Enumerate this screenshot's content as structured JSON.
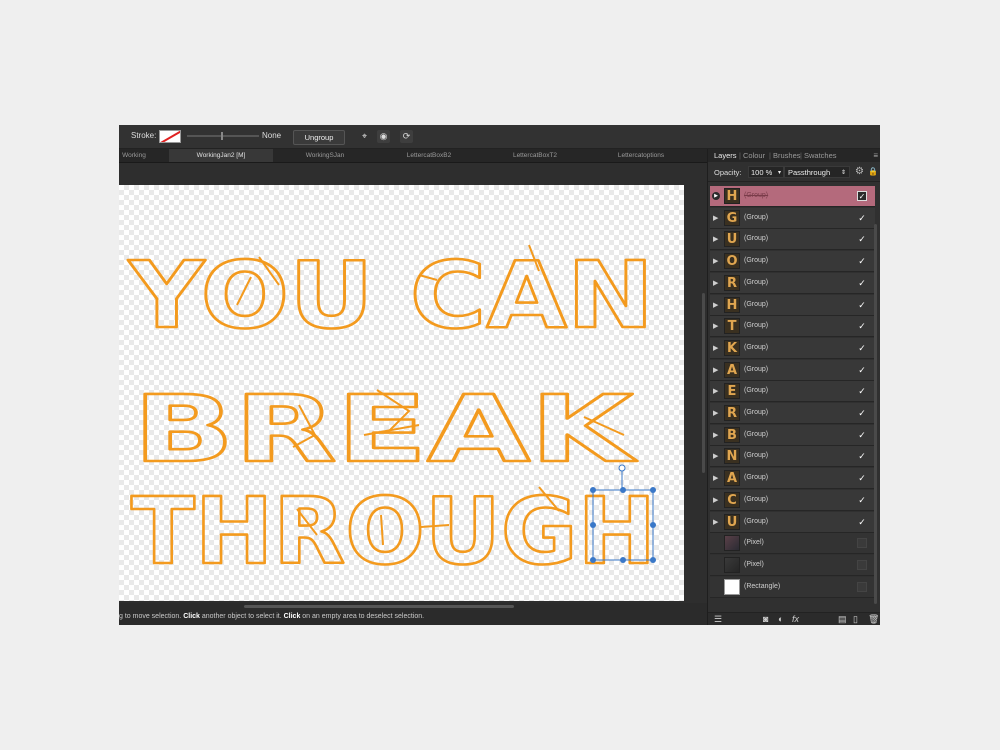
{
  "toolbar": {
    "stroke_label": "Stroke:",
    "stroke_value": "None",
    "ungroup_label": "Ungroup"
  },
  "doc_tabs": [
    "Working",
    "WorkingJan2 [M]",
    "WorkingSJan",
    "LettercatBoxB2",
    "LettercatBoxT2",
    "Lettercatoptions"
  ],
  "canvas": {
    "artwork_lines": [
      "YOU CAN",
      "BREAK",
      "THROUGH"
    ],
    "stroke_color": "#f39a1e",
    "selection_color": "#3a78c8"
  },
  "status": {
    "part1": "g to move selection. ",
    "click1": "Click",
    "part2": " another object to select it. ",
    "click2": "Click",
    "part3": " on an empty area to deselect selection."
  },
  "panel": {
    "tabs": [
      "Layers",
      "Colour",
      "Brushes",
      "Swatches"
    ],
    "opacity_label": "Opacity:",
    "opacity_value": "100 %",
    "blend_mode": "Passthrough",
    "selected_color": "#b46a7c",
    "layers": [
      {
        "glyph": "H",
        "name": "(Group)",
        "visible": true,
        "selected": true
      },
      {
        "glyph": "G",
        "name": "(Group)",
        "visible": true
      },
      {
        "glyph": "U",
        "name": "(Group)",
        "visible": true
      },
      {
        "glyph": "O",
        "name": "(Group)",
        "visible": true
      },
      {
        "glyph": "R",
        "name": "(Group)",
        "visible": true
      },
      {
        "glyph": "H",
        "name": "(Group)",
        "visible": true
      },
      {
        "glyph": "T",
        "name": "(Group)",
        "visible": true
      },
      {
        "glyph": "K",
        "name": "(Group)",
        "visible": true
      },
      {
        "glyph": "A",
        "name": "(Group)",
        "visible": true
      },
      {
        "glyph": "E",
        "name": "(Group)",
        "visible": true
      },
      {
        "glyph": "R",
        "name": "(Group)",
        "visible": true
      },
      {
        "glyph": "B",
        "name": "(Group)",
        "visible": true
      },
      {
        "glyph": "N",
        "name": "(Group)",
        "visible": true
      },
      {
        "glyph": "A",
        "name": "(Group)",
        "visible": true
      },
      {
        "glyph": "C",
        "name": "(Group)",
        "visible": true
      },
      {
        "glyph": "U",
        "name": "(Group)",
        "visible": true
      },
      {
        "glyph": "",
        "name": "(Pixel)",
        "visible": false,
        "kind": "pixel"
      },
      {
        "glyph": "",
        "name": "(Pixel)",
        "visible": false,
        "kind": "pixel2"
      },
      {
        "glyph": "",
        "name": "(Rectangle)",
        "visible": false,
        "kind": "rect"
      }
    ]
  }
}
